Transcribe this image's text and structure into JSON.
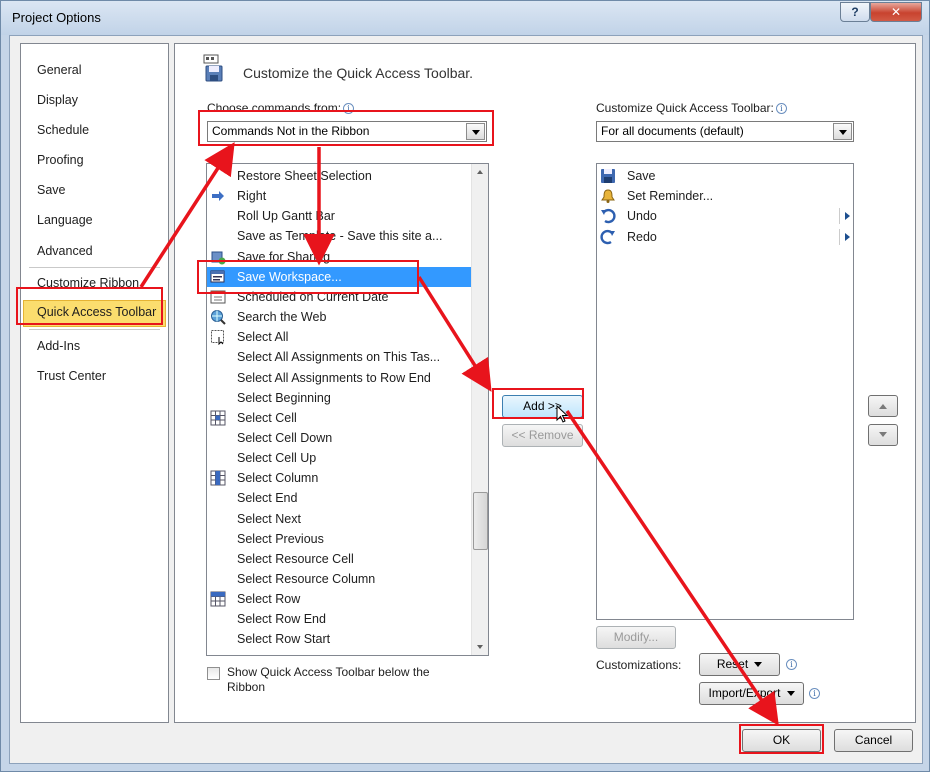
{
  "window": {
    "title": "Project Options",
    "help_label": "?",
    "close_label": "✕"
  },
  "nav": {
    "items": [
      {
        "label": "General"
      },
      {
        "label": "Display"
      },
      {
        "label": "Schedule"
      },
      {
        "label": "Proofing"
      },
      {
        "label": "Save"
      },
      {
        "label": "Language"
      },
      {
        "label": "Advanced"
      },
      {
        "label": "Customize Ribbon"
      },
      {
        "label": "Quick Access Toolbar",
        "selected": true
      },
      {
        "label": "Add-Ins"
      },
      {
        "label": "Trust Center"
      }
    ]
  },
  "header": {
    "title": "Customize the Quick Access Toolbar."
  },
  "choose": {
    "label": "Choose commands from:",
    "value": "Commands Not in the Ribbon"
  },
  "customize": {
    "label": "Customize Quick Access Toolbar:",
    "value": "For all documents (default)"
  },
  "commands": [
    {
      "label": "Restore Sheet Selection",
      "icon": ""
    },
    {
      "label": "Right",
      "icon": "arrow-right-icon"
    },
    {
      "label": "Roll Up Gantt Bar",
      "icon": ""
    },
    {
      "label": "Save as Template - Save this site a...",
      "icon": ""
    },
    {
      "label": "Save for Sharing",
      "icon": "share-icon"
    },
    {
      "label": "Save Workspace...",
      "icon": "workspace-icon",
      "selected": true
    },
    {
      "label": "Scheduled on Current Date",
      "icon": "calendar-icon"
    },
    {
      "label": "Search the Web",
      "icon": "globe-search-icon"
    },
    {
      "label": "Select All",
      "icon": "select-all-icon"
    },
    {
      "label": "Select All Assignments on This Tas...",
      "icon": ""
    },
    {
      "label": "Select All Assignments to Row End",
      "icon": ""
    },
    {
      "label": "Select Beginning",
      "icon": ""
    },
    {
      "label": "Select Cell",
      "icon": "grid-icon"
    },
    {
      "label": "Select Cell Down",
      "icon": ""
    },
    {
      "label": "Select Cell Up",
      "icon": ""
    },
    {
      "label": "Select Column",
      "icon": "column-icon"
    },
    {
      "label": "Select End",
      "icon": ""
    },
    {
      "label": "Select Next",
      "icon": ""
    },
    {
      "label": "Select Previous",
      "icon": ""
    },
    {
      "label": "Select Resource Cell",
      "icon": ""
    },
    {
      "label": "Select Resource Column",
      "icon": ""
    },
    {
      "label": "Select Row",
      "icon": "row-icon"
    },
    {
      "label": "Select Row End",
      "icon": ""
    },
    {
      "label": "Select Row Start",
      "icon": ""
    }
  ],
  "toolbar_items": [
    {
      "label": "Save",
      "icon": "floppy-disk-icon",
      "submenu": false
    },
    {
      "label": "Set Reminder...",
      "icon": "bell-icon",
      "submenu": false
    },
    {
      "label": "Undo",
      "icon": "undo-icon",
      "submenu": true
    },
    {
      "label": "Redo",
      "icon": "redo-icon",
      "submenu": true
    }
  ],
  "buttons": {
    "add": "Add >>",
    "remove": "<< Remove",
    "modify": "Modify...",
    "reset": "Reset",
    "import_export": "Import/Export",
    "ok": "OK",
    "cancel": "Cancel"
  },
  "customizations_label": "Customizations:",
  "show_below": {
    "label": "Show Quick Access Toolbar below the Ribbon",
    "checked": false
  },
  "colors": {
    "highlight": "#e8141c",
    "selection": "#3399ff",
    "nav_selected": "#fbdd6e"
  }
}
